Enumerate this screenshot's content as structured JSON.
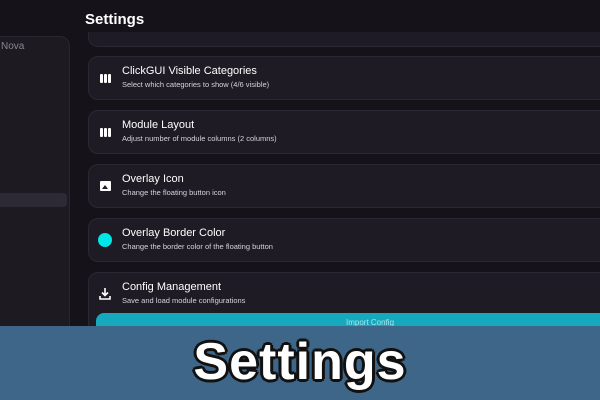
{
  "header": {
    "title": "Settings"
  },
  "sidebar": {
    "brand_fragment": "Nova"
  },
  "settings": [
    {
      "title": "ClickGUI Visible Categories",
      "description": "Select which categories to show (4/6 visible)",
      "icon": "columns-icon"
    },
    {
      "title": "Module Layout",
      "description": "Adjust number of module columns (2 columns)",
      "icon": "columns-icon"
    },
    {
      "title": "Overlay Icon",
      "description": "Change the floating button icon",
      "icon": "image-icon"
    },
    {
      "title": "Overlay Border Color",
      "description": "Change the border color of the floating button",
      "icon": "color-swatch",
      "color": "#00e5e5"
    },
    {
      "title": "Config Management",
      "description": "Save and load module configurations",
      "icon": "download-icon"
    }
  ],
  "config": {
    "import_label": "Import Config"
  },
  "banner": {
    "title": "Settings"
  },
  "colors": {
    "background": "#151219",
    "card": "#1e1b24",
    "accent": "#16a9bd",
    "banner": "#3d6688"
  }
}
